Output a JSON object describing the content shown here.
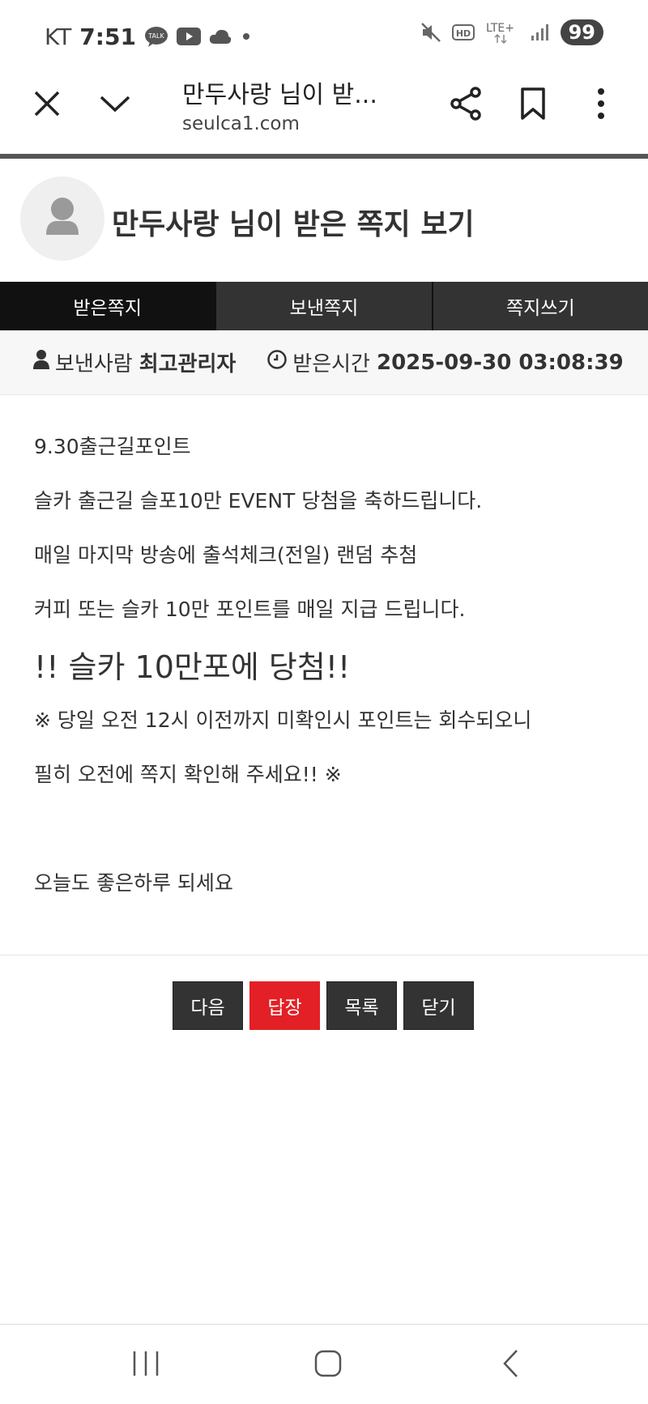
{
  "status_bar": {
    "carrier": "KT",
    "time": "7:51",
    "network": "LTE+",
    "hd_label": "HD",
    "battery": "99",
    "talk_label": "TALK"
  },
  "browser": {
    "title": "만두사랑 님이 받...",
    "url": "seulca1.com"
  },
  "page": {
    "title": "만두사랑 님이 받은 쪽지 보기"
  },
  "tabs": [
    {
      "label": "받은쪽지",
      "active": true
    },
    {
      "label": "보낸쪽지",
      "active": false
    },
    {
      "label": "쪽지쓰기",
      "active": false
    }
  ],
  "info": {
    "sender_label": "보낸사람",
    "sender_value": "최고관리자",
    "time_label": "받은시간",
    "time_value": "2025-09-30 03:08:39"
  },
  "message": {
    "lines": [
      "9.30출근길포인트",
      "슬카 출근길 슬포10만 EVENT 당첨을 축하드립니다.",
      "매일 마지막 방송에 출석체크(전일) 랜덤 추첨",
      "커피 또는 슬카 10만 포인트를 매일 지급 드립니다.",
      "!! 슬카 10만포에 당첨!!",
      "※ 당일 오전 12시 이전까지 미확인시 포인트는 회수되오니",
      "필히 오전에 쪽지 확인해 주세요!! ※",
      "",
      "오늘도 좋은하루 되세요"
    ]
  },
  "buttons": {
    "next": "다음",
    "reply": "답장",
    "list": "목록",
    "close": "닫기"
  },
  "colors": {
    "accent_red": "#e32025",
    "dark": "#333333",
    "tab_active": "#111111"
  }
}
